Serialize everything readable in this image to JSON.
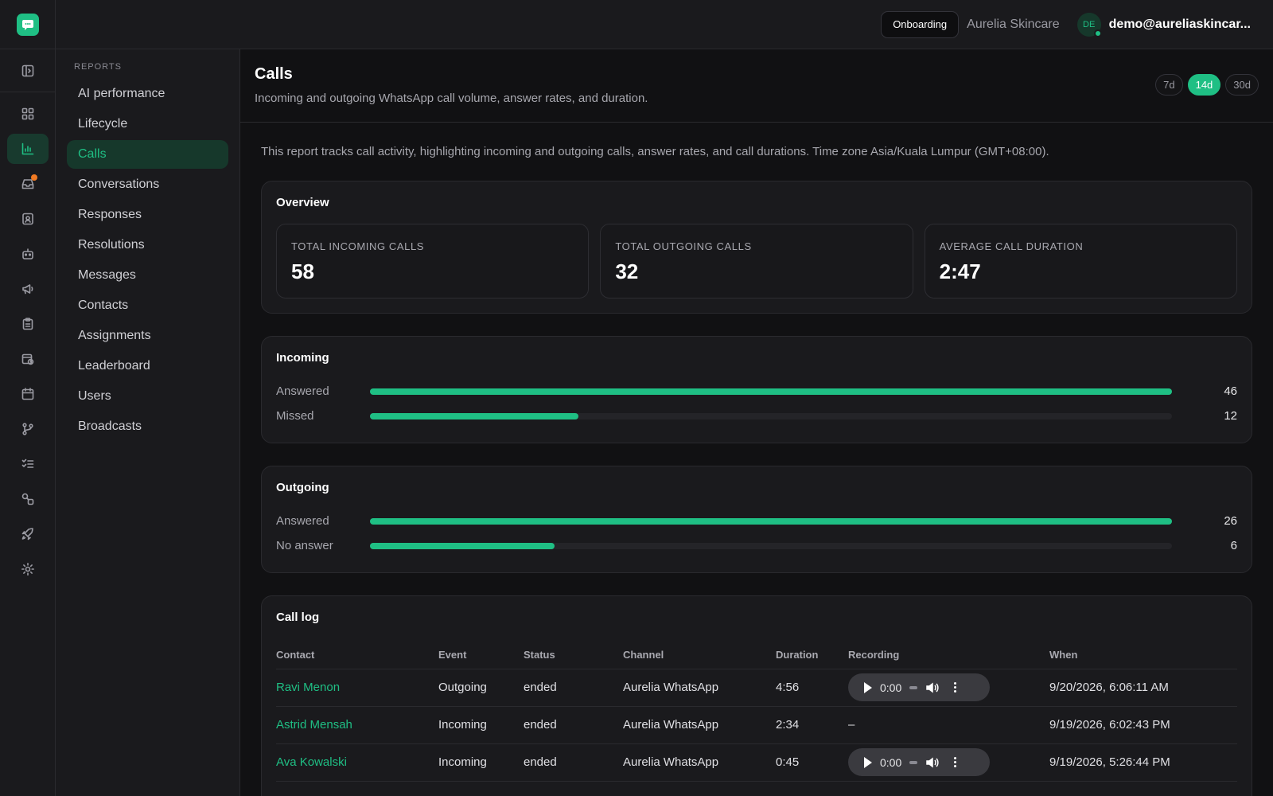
{
  "topbar": {
    "onboarding_label": "Onboarding",
    "org_name": "Aurelia Skincare",
    "avatar_initials": "DE",
    "user_email": "demo@aureliaskincar..."
  },
  "rail": {
    "icons": [
      "dashboard-icon",
      "reports-icon",
      "inbox-icon",
      "contacts-icon",
      "bot-icon",
      "broadcast-icon",
      "clipboard-icon",
      "schedule-icon",
      "calendar-icon",
      "workflow-icon",
      "checklist-icon",
      "integrations-icon",
      "rocket-icon",
      "settings-icon"
    ],
    "active": "reports-icon",
    "badge_color": "#f07a23"
  },
  "subnav": {
    "heading": "REPORTS",
    "items": [
      "AI performance",
      "Lifecycle",
      "Calls",
      "Conversations",
      "Responses",
      "Resolutions",
      "Messages",
      "Contacts",
      "Assignments",
      "Leaderboard",
      "Users",
      "Broadcasts"
    ],
    "active": "Calls"
  },
  "page": {
    "title": "Calls",
    "subtitle": "Incoming and outgoing WhatsApp call volume, answer rates, and duration.",
    "ranges": [
      "7d",
      "14d",
      "30d"
    ],
    "active_range": "14d",
    "intro": "This report tracks call activity, highlighting incoming and outgoing calls, answer rates, and call durations. Time zone Asia/Kuala Lumpur (GMT+08:00)."
  },
  "overview": {
    "title": "Overview",
    "stats": [
      {
        "label": "TOTAL INCOMING CALLS",
        "value": "58"
      },
      {
        "label": "TOTAL OUTGOING CALLS",
        "value": "32"
      },
      {
        "label": "AVERAGE CALL DURATION",
        "value": "2:47"
      }
    ]
  },
  "incoming": {
    "title": "Incoming",
    "rows": [
      {
        "label": "Answered",
        "value": "46",
        "fraction": 1.0
      },
      {
        "label": "Missed",
        "value": "12",
        "fraction": 0.26
      }
    ]
  },
  "outgoing": {
    "title": "Outgoing",
    "rows": [
      {
        "label": "Answered",
        "value": "26",
        "fraction": 1.0
      },
      {
        "label": "No answer",
        "value": "6",
        "fraction": 0.23
      }
    ]
  },
  "call_log": {
    "title": "Call log",
    "columns": [
      "Contact",
      "Event",
      "Status",
      "Channel",
      "Duration",
      "Recording",
      "When"
    ],
    "rows": [
      {
        "contact": "Ravi Menon",
        "event": "Outgoing",
        "status": "ended",
        "channel": "Aurelia WhatsApp",
        "duration": "4:56",
        "recording": "0:00",
        "has_recording": true,
        "when": "9/20/2026, 6:06:11 AM"
      },
      {
        "contact": "Astrid Mensah",
        "event": "Incoming",
        "status": "ended",
        "channel": "Aurelia WhatsApp",
        "duration": "2:34",
        "recording": "–",
        "has_recording": false,
        "when": "9/19/2026, 6:02:43 PM"
      },
      {
        "contact": "Ava Kowalski",
        "event": "Incoming",
        "status": "ended",
        "channel": "Aurelia WhatsApp",
        "duration": "0:45",
        "recording": "0:00",
        "has_recording": true,
        "when": "9/19/2026, 5:26:44 PM"
      }
    ]
  },
  "colors": {
    "accent": "#1fbf84",
    "background": "#111113",
    "panel": "#1a1a1d"
  }
}
